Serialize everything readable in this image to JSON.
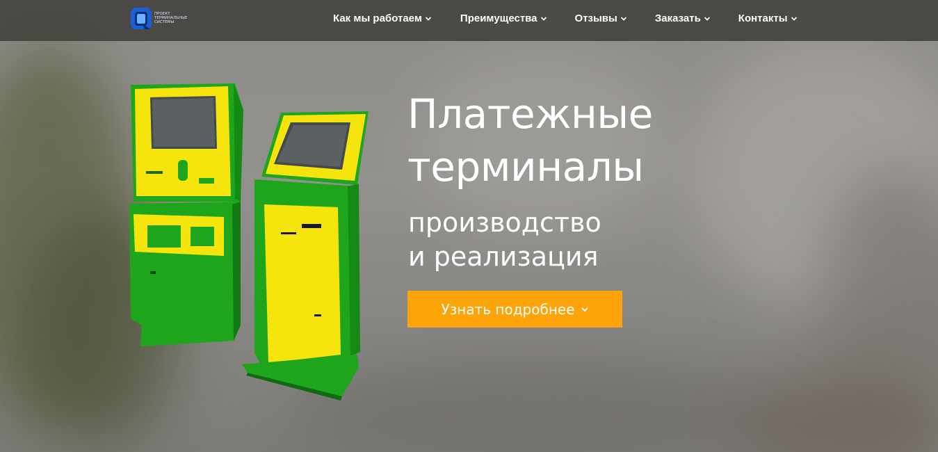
{
  "brand": {
    "logo_lines": [
      "ПРОЕКТ",
      "ТЕРМИНАЛЬНЫЕ",
      "СИСТЕМЫ"
    ],
    "logo_color": "#1b5fd6"
  },
  "nav": {
    "items": [
      {
        "label": "Как мы работаем",
        "icon": "chevron-down-icon"
      },
      {
        "label": "Преимущества",
        "icon": "chevron-down-icon"
      },
      {
        "label": "Отзывы",
        "icon": "chevron-down-icon"
      },
      {
        "label": "Заказать",
        "icon": "chevron-down-icon"
      },
      {
        "label": "Контакты",
        "icon": "chevron-down-icon"
      }
    ]
  },
  "hero": {
    "title_line1": "Платежные",
    "title_line2": "терминалы",
    "subtitle_line1": "производство",
    "subtitle_line2": "и реализация",
    "cta_label": "Узнать подробнее",
    "cta_color": "#fca40a",
    "kiosk_colors": {
      "body": "#1ea51c",
      "panel": "#f5e50c"
    }
  }
}
